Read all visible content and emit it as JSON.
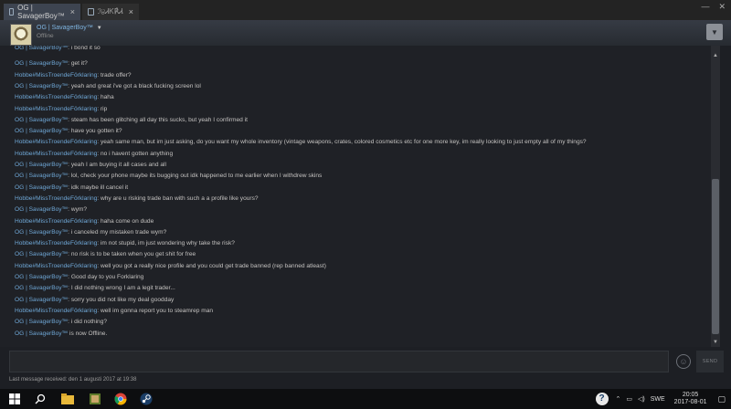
{
  "tabs": [
    {
      "label": "OG | SavagerBoy™"
    },
    {
      "label": "ℐ੪ᏗᏦ℟ᏗᏁ\\_ℒ"
    }
  ],
  "window": {
    "minimize": "—",
    "close": "✕"
  },
  "header": {
    "name": "OG | SavagerBoy™",
    "status": "Offline"
  },
  "messages": [
    {
      "sender": "OG | SavagerBoy™",
      "text": ": i bond it so"
    },
    {
      "sender": "OG | SavagerBoy™",
      "text": ": get it?"
    },
    {
      "sender": "Hobbe#MissTroendeFörklaring",
      "text": ": trade offer?"
    },
    {
      "sender": "OG | SavagerBoy™",
      "text": ": yeah and great i've got a black fucking screen lol"
    },
    {
      "sender": "Hobbe#MissTroendeFörklaring",
      "text": ": haha"
    },
    {
      "sender": "Hobbe#MissTroendeFörklaring",
      "text": ": rip"
    },
    {
      "sender": "OG | SavagerBoy™",
      "text": ": steam has been glitching all day this sucks, but yeah I confirmed it"
    },
    {
      "sender": "OG | SavagerBoy™",
      "text": ": have you gotten it?"
    },
    {
      "sender": "Hobbe#MissTroendeFörklaring",
      "text": ": yeah same man, but im just asking, do you want my whole inventory (vintage weapons, crates, colored cosmetics etc for one more key, im really looking to just empty all of my things?"
    },
    {
      "sender": "Hobbe#MissTroendeFörklaring",
      "text": ": no i havent gotten anything"
    },
    {
      "sender": "OG | SavagerBoy™",
      "text": ": yeah I am buying it all cases and all"
    },
    {
      "sender": "OG | SavagerBoy™",
      "text": ": lol, check your phone maybe its bugging out idk happened to me earlier when I withdrew skins"
    },
    {
      "sender": "OG | SavagerBoy™",
      "text": ": idk maybe ill cancel it"
    },
    {
      "sender": "Hobbe#MissTroendeFörklaring",
      "text": ": why are u risking trade ban with such a a profile like yours?"
    },
    {
      "sender": "OG | SavagerBoy™",
      "text": ": wym?"
    },
    {
      "sender": "Hobbe#MissTroendeFörklaring",
      "text": ": haha come on dude"
    },
    {
      "sender": "OG | SavagerBoy™",
      "text": ": i canceled my mistaken trade wym?"
    },
    {
      "sender": "Hobbe#MissTroendeFörklaring",
      "text": ": im not stupid, im just wondering why take the risk?"
    },
    {
      "sender": "OG | SavagerBoy™",
      "text": ": no risk is to be taken when you get shit for free"
    },
    {
      "sender": "Hobbe#MissTroendeFörklaring",
      "text": ": well you got a really nice profile and you could get trade banned (rep banned atleast)"
    },
    {
      "sender": "OG | SavagerBoy™",
      "text": ": Good day to you Forklaring"
    },
    {
      "sender": "OG | SavagerBoy™",
      "text": ": I did nothing wrong I am a legit trader..."
    },
    {
      "sender": "OG | SavagerBoy™",
      "text": ": sorry you did not like my deal goodday"
    },
    {
      "sender": "Hobbe#MissTroendeFörklaring",
      "text": ": well im gonna report you to steamrep man"
    },
    {
      "sender": "OG | SavagerBoy™",
      "text": ": i did nothing?"
    },
    {
      "sender": "OG | SavagerBoy™",
      "text": " is now Offline."
    }
  ],
  "compose": {
    "send_label": "SEND",
    "emoji_icon": "smiley-icon",
    "value": ""
  },
  "footer": {
    "last_message": "Last message received: den 1 augusti 2017 at 19:38"
  },
  "taskbar": {
    "language": "SWE",
    "time": "20:05",
    "date": "2017-08-01"
  },
  "colors": {
    "name": "#6fa7d6",
    "text": "#c4c2c0",
    "background": "#1f2126"
  }
}
